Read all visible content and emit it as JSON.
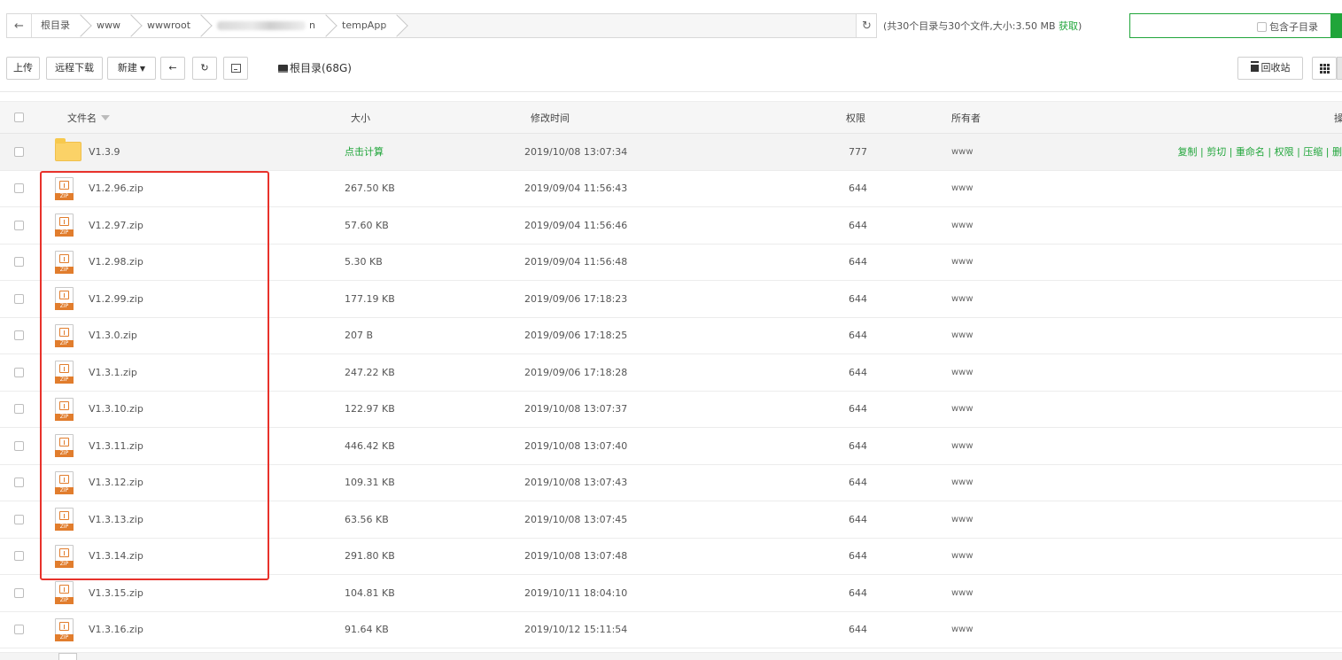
{
  "breadcrumb": {
    "items": [
      "根目录",
      "www",
      "wwwroot",
      "n",
      "tempApp"
    ]
  },
  "summary": {
    "text": "(共30个目录与30个文件,大小:3.50 MB ",
    "link": "获取",
    "close": ")"
  },
  "search": {
    "include_subdir_label": "包含子目录"
  },
  "toolbar": {
    "upload_label": "上传",
    "remote_download_label": "远程下载",
    "new_label": "新建",
    "disk_label": "根目录(68G)",
    "recycle_label": "回收站"
  },
  "table": {
    "headers": {
      "name": "文件名",
      "size": "大小",
      "mtime": "修改时间",
      "perm": "权限",
      "owner": "所有者",
      "ops": "操"
    },
    "folder": {
      "name": "V1.3.9",
      "size": "点击计算",
      "mtime": "2019/10/08 13:07:34",
      "perm": "777",
      "owner": "www",
      "ops": "复制 | 剪切 | 重命名 | 权限 | 压缩 | 删"
    },
    "files": [
      {
        "name": "V1.2.96.zip",
        "size": "267.50 KB",
        "mtime": "2019/09/04 11:56:43",
        "perm": "644",
        "owner": "www"
      },
      {
        "name": "V1.2.97.zip",
        "size": "57.60 KB",
        "mtime": "2019/09/04 11:56:46",
        "perm": "644",
        "owner": "www"
      },
      {
        "name": "V1.2.98.zip",
        "size": "5.30 KB",
        "mtime": "2019/09/04 11:56:48",
        "perm": "644",
        "owner": "www"
      },
      {
        "name": "V1.2.99.zip",
        "size": "177.19 KB",
        "mtime": "2019/09/06 17:18:23",
        "perm": "644",
        "owner": "www"
      },
      {
        "name": "V1.3.0.zip",
        "size": "207 B",
        "mtime": "2019/09/06 17:18:25",
        "perm": "644",
        "owner": "www"
      },
      {
        "name": "V1.3.1.zip",
        "size": "247.22 KB",
        "mtime": "2019/09/06 17:18:28",
        "perm": "644",
        "owner": "www"
      },
      {
        "name": "V1.3.10.zip",
        "size": "122.97 KB",
        "mtime": "2019/10/08 13:07:37",
        "perm": "644",
        "owner": "www"
      },
      {
        "name": "V1.3.11.zip",
        "size": "446.42 KB",
        "mtime": "2019/10/08 13:07:40",
        "perm": "644",
        "owner": "www"
      },
      {
        "name": "V1.3.12.zip",
        "size": "109.31 KB",
        "mtime": "2019/10/08 13:07:43",
        "perm": "644",
        "owner": "www"
      },
      {
        "name": "V1.3.13.zip",
        "size": "63.56 KB",
        "mtime": "2019/10/08 13:07:45",
        "perm": "644",
        "owner": "www"
      },
      {
        "name": "V1.3.14.zip",
        "size": "291.80 KB",
        "mtime": "2019/10/08 13:07:48",
        "perm": "644",
        "owner": "www"
      },
      {
        "name": "V1.3.15.zip",
        "size": "104.81 KB",
        "mtime": "2019/10/11 18:04:10",
        "perm": "644",
        "owner": "www"
      },
      {
        "name": "V1.3.16.zip",
        "size": "91.64 KB",
        "mtime": "2019/10/12 15:11:54",
        "perm": "644",
        "owner": "www"
      }
    ],
    "zip_badge": "ZIP"
  },
  "colors": {
    "accent": "#20a53a",
    "highlight": "#e8322b",
    "zip": "#e17d2d",
    "folder": "#fbd267"
  },
  "icons": {
    "back": "arrow-left-icon",
    "refresh": "refresh-icon",
    "terminal": "terminal-icon",
    "disk": "disk-icon",
    "trash": "trash-icon",
    "grid": "grid-view-icon"
  }
}
